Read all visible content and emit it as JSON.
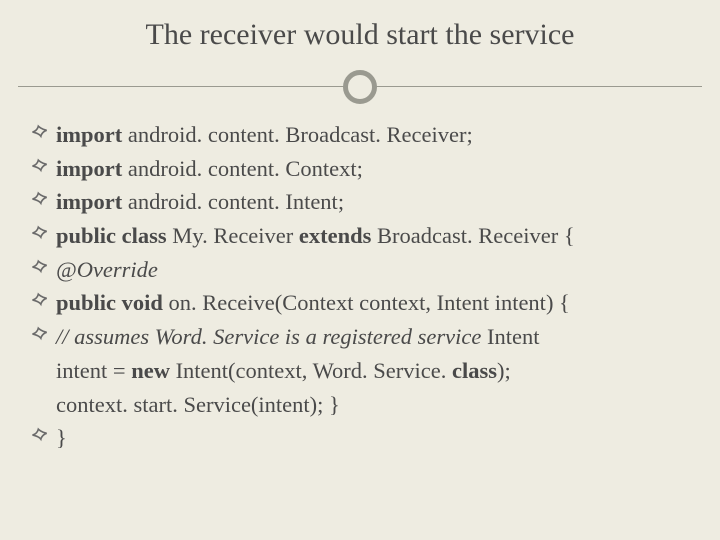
{
  "title": "The receiver would start the service",
  "lines": {
    "l1": {
      "kw": "import",
      "rest": " android. content. Broadcast. Receiver;"
    },
    "l2": {
      "kw": "import",
      "rest": " android. content. Context;"
    },
    "l3": {
      "kw": "import",
      "rest": " android. content. Intent;"
    },
    "l4": {
      "p1": " ",
      "kw1": "public class",
      "p2": " My. Receiver ",
      "kw2": "extends",
      "p3": " Broadcast. Receiver {"
    },
    "l5": {
      "italic": " @Override"
    },
    "l6": {
      "p1": " ",
      "kw": "public void",
      "p2": " on. Receive(Context context, Intent intent) {"
    },
    "l7": {
      "comment": " // assumes Word. Service is a registered service",
      "tail": "    Intent"
    },
    "l7b": {
      "p1": "intent = ",
      "kw1": "new",
      "p2": " Intent(context, Word. Service. ",
      "kw2": "class",
      "p3": ");"
    },
    "l7c": "context. start. Service(intent);  }",
    "l8": " }"
  }
}
